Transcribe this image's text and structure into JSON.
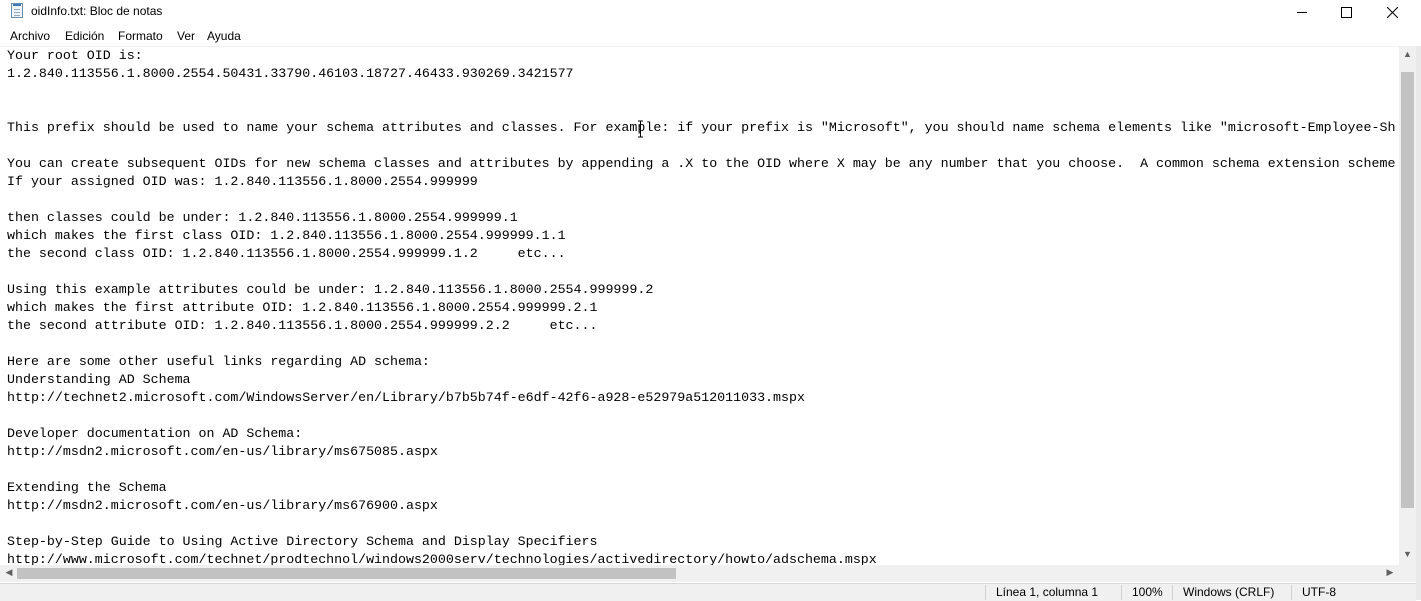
{
  "window": {
    "title": "oidInfo.txt: Bloc de notas",
    "app_icon": "notepad-icon",
    "controls": [
      "minimize-icon",
      "maximize-icon",
      "close-icon"
    ]
  },
  "menu": [
    "Archivo",
    "Edición",
    "Formato",
    "Ver",
    "Ayuda"
  ],
  "editor": {
    "lines": [
      "Your root OID is:",
      "1.2.840.113556.1.8000.2554.50431.33790.46103.18727.46433.930269.3421577",
      "",
      "",
      "This prefix should be used to name your schema attributes and classes. For example: if your prefix is \"Microsoft\", you should name schema elements like \"microsoft-Employee-Sh",
      "",
      "You can create subsequent OIDs for new schema classes and attributes by appending a .X to the OID where X may be any number that you choose.  A common schema extension scheme",
      "If your assigned OID was: 1.2.840.113556.1.8000.2554.999999",
      "",
      "then classes could be under: 1.2.840.113556.1.8000.2554.999999.1",
      "which makes the first class OID: 1.2.840.113556.1.8000.2554.999999.1.1",
      "the second class OID: 1.2.840.113556.1.8000.2554.999999.1.2     etc...",
      "",
      "Using this example attributes could be under: 1.2.840.113556.1.8000.2554.999999.2",
      "which makes the first attribute OID: 1.2.840.113556.1.8000.2554.999999.2.1",
      "the second attribute OID: 1.2.840.113556.1.8000.2554.999999.2.2     etc...",
      "",
      "Here are some other useful links regarding AD schema:",
      "Understanding AD Schema",
      "http://technet2.microsoft.com/WindowsServer/en/Library/b7b5b74f-e6df-42f6-a928-e52979a512011033.mspx",
      "",
      "Developer documentation on AD Schema:",
      "http://msdn2.microsoft.com/en-us/library/ms675085.aspx",
      "",
      "Extending the Schema",
      "http://msdn2.microsoft.com/en-us/library/ms676900.aspx",
      "",
      "Step-by-Step Guide to Using Active Directory Schema and Display Specifiers",
      "http://www.microsoft.com/technet/prodtechnol/windows2000serv/technologies/activedirectory/howto/adschema.mspx"
    ]
  },
  "status": {
    "position": "Línea 1, columna 1",
    "zoom": "100%",
    "line_ending": "Windows (CRLF)",
    "encoding": "UTF-8"
  }
}
